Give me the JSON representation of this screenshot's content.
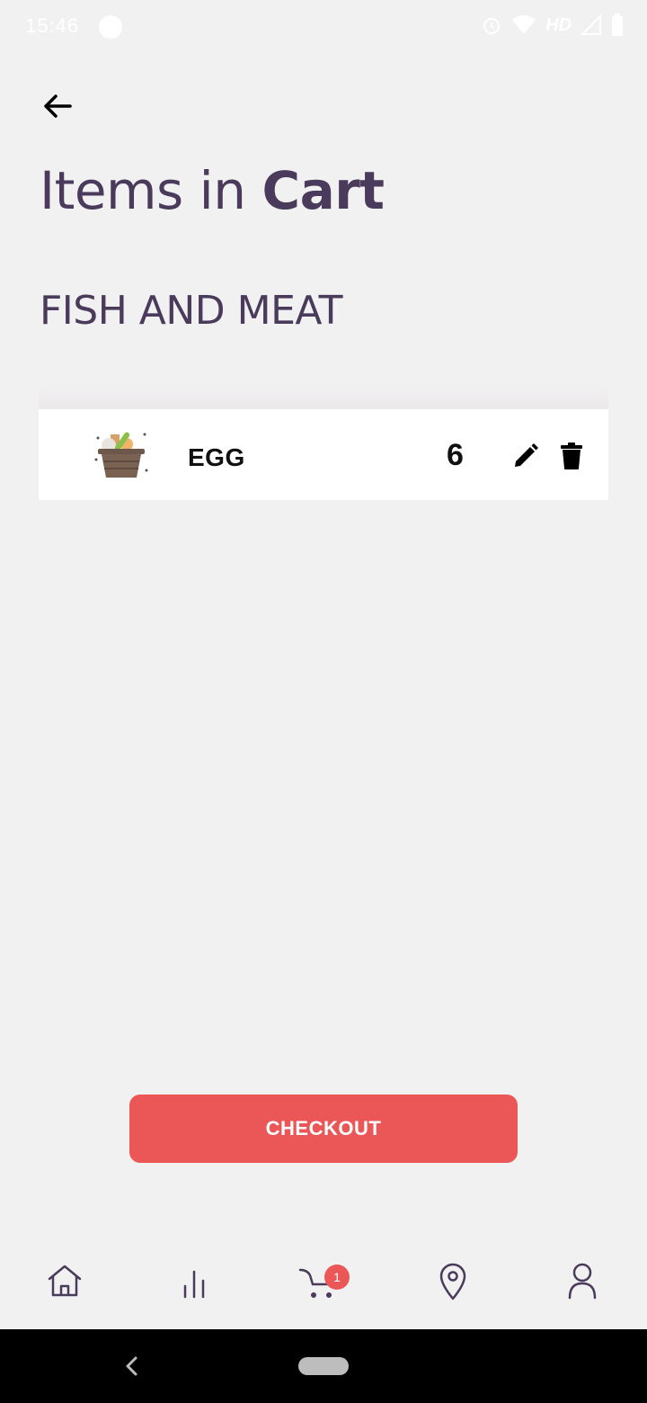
{
  "status_bar": {
    "time": "15:46",
    "network_label": "HD",
    "icons": [
      "app-notification-icon",
      "alarm-icon",
      "wifi-icon",
      "signal-icon",
      "battery-icon"
    ]
  },
  "header": {
    "back_icon": "arrow-left-icon",
    "title_regular": "Items in ",
    "title_bold": "Cart"
  },
  "category": {
    "title": "FISH AND MEAT"
  },
  "cart_items": [
    {
      "name": "EGG",
      "quantity": "6",
      "thumbnail_icon": "grocery-basket-icon",
      "edit_icon": "pencil-icon",
      "delete_icon": "trash-icon"
    }
  ],
  "checkout": {
    "label": "CHECKOUT"
  },
  "bottom_nav": {
    "items": [
      "home-icon",
      "stats-icon",
      "cart-icon",
      "location-icon",
      "profile-icon"
    ],
    "cart_badge": "1"
  },
  "colors": {
    "background": "#f2f1f2",
    "title": "#4a3a5c",
    "accent": "#eb5757",
    "nav_icon": "#4a3a5c"
  }
}
